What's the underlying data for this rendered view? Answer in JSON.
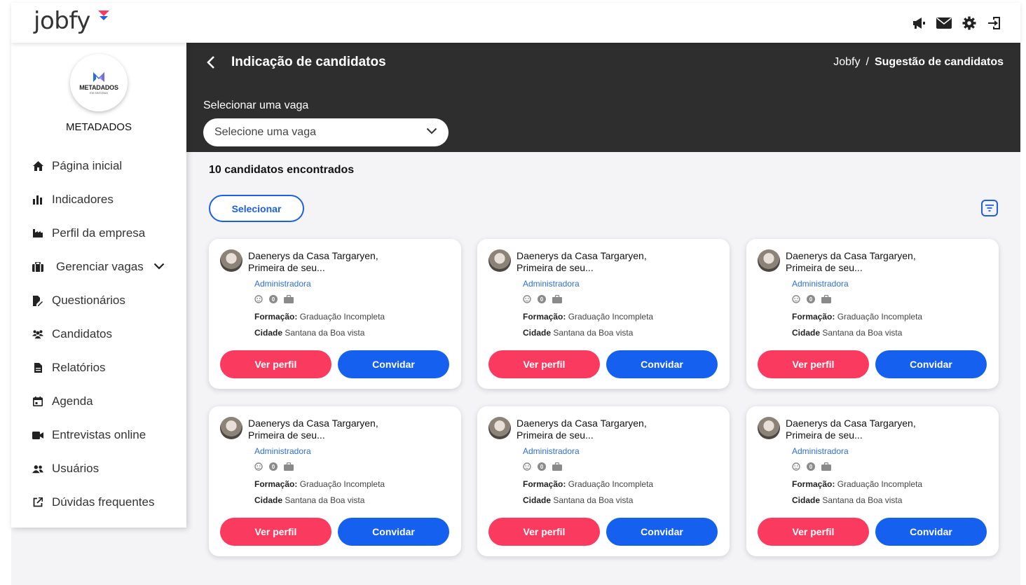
{
  "app": {
    "logo_text": "jobfy",
    "brand_color": "#fb3a5f",
    "accent_color": "#1560ee"
  },
  "topbar": {
    "icons": [
      "megaphone-icon",
      "mail-icon",
      "gear-icon",
      "logout-icon"
    ]
  },
  "sidebar": {
    "company_logo_text": "METADADOS",
    "company_logo_subtitle": "EM SINTONIA",
    "company_name": "METADADOS",
    "items": [
      {
        "label": "Página inicial",
        "icon": "home-icon"
      },
      {
        "label": "Indicadores",
        "icon": "bar-chart-icon"
      },
      {
        "label": "Perfil da empresa",
        "icon": "factory-icon"
      },
      {
        "label": "Gerenciar vagas",
        "icon": "briefcase-icon"
      },
      {
        "label": "Questionários",
        "icon": "file-edit-icon"
      },
      {
        "label": "Candidatos",
        "icon": "users-icon"
      },
      {
        "label": "Relatórios",
        "icon": "document-icon"
      },
      {
        "label": "Agenda",
        "icon": "calendar-icon"
      },
      {
        "label": "Entrevistas online",
        "icon": "video-icon"
      },
      {
        "label": "Usuários",
        "icon": "user-group-icon"
      },
      {
        "label": "Dúvidas frequentes",
        "icon": "external-link-icon"
      }
    ]
  },
  "header": {
    "title": "Indicação de candidatos",
    "breadcrumb": {
      "root": "Jobfy",
      "separator": "/",
      "current": "Sugestão de candidatos"
    },
    "select_label": "Selecionar uma vaga",
    "select_placeholder": "Selecione uma vaga"
  },
  "main": {
    "found_text": "10 candidatos encontrados",
    "select_button": "Selecionar",
    "cards": [
      {
        "name": "Daenerys da Casa Targaryen, Primeira de seu...",
        "role": "Administradora",
        "badge": "0",
        "formacao_label": "Formação:",
        "formacao": "Graduação Incompleta",
        "cidade_label": "Cidade",
        "cidade": "Santana da Boa vista",
        "ver_label": "Ver perfil",
        "convidar_label": "Convidar"
      },
      {
        "name": "Daenerys da Casa Targaryen, Primeira de seu...",
        "role": "Administradora",
        "badge": "0",
        "formacao_label": "Formação:",
        "formacao": "Graduação Incompleta",
        "cidade_label": "Cidade",
        "cidade": "Santana da Boa vista",
        "ver_label": "Ver perfil",
        "convidar_label": "Convidar"
      },
      {
        "name": "Daenerys da Casa Targaryen, Primeira de seu...",
        "role": "Administradora",
        "badge": "0",
        "formacao_label": "Formação:",
        "formacao": "Graduação Incompleta",
        "cidade_label": "Cidade",
        "cidade": "Santana da Boa vista",
        "ver_label": "Ver perfil",
        "convidar_label": "Convidar"
      },
      {
        "name": "Daenerys da Casa Targaryen, Primeira de seu...",
        "role": "Administradora",
        "badge": "0",
        "formacao_label": "Formação:",
        "formacao": "Graduação Incompleta",
        "cidade_label": "Cidade",
        "cidade": "Santana da Boa vista",
        "ver_label": "Ver perfil",
        "convidar_label": "Convidar"
      },
      {
        "name": "Daenerys da Casa Targaryen, Primeira de seu...",
        "role": "Administradora",
        "badge": "0",
        "formacao_label": "Formação:",
        "formacao": "Graduação Incompleta",
        "cidade_label": "Cidade",
        "cidade": "Santana da Boa vista",
        "ver_label": "Ver perfil",
        "convidar_label": "Convidar"
      },
      {
        "name": "Daenerys da Casa Targaryen, Primeira de seu...",
        "role": "Administradora",
        "badge": "0",
        "formacao_label": "Formação:",
        "formacao": "Graduação Incompleta",
        "cidade_label": "Cidade",
        "cidade": "Santana da Boa vista",
        "ver_label": "Ver perfil",
        "convidar_label": "Convidar"
      }
    ]
  }
}
